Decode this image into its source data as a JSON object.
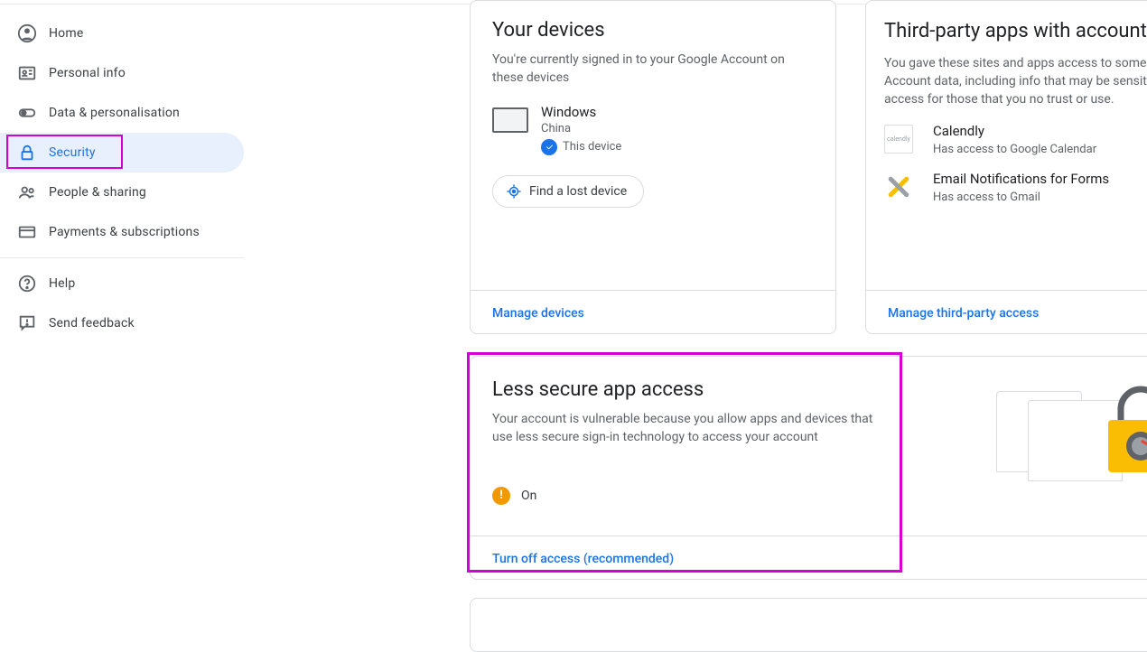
{
  "sidebar": {
    "items": [
      {
        "label": "Home"
      },
      {
        "label": "Personal info"
      },
      {
        "label": "Data & personalisation"
      },
      {
        "label": "Security"
      },
      {
        "label": "People & sharing"
      },
      {
        "label": "Payments & subscriptions"
      }
    ],
    "secondary": [
      {
        "label": "Help"
      },
      {
        "label": "Send feedback"
      }
    ]
  },
  "devices": {
    "title": "Your devices",
    "subtitle": "You're currently signed in to your Google Account on these devices",
    "device_name": "Windows",
    "device_location": "China",
    "this_device_label": "This device",
    "find_button": "Find a lost device",
    "manage_link": "Manage devices"
  },
  "third_party": {
    "title": "Third-party apps with account access",
    "subtitle": "You gave these sites and apps access to some Google Account data, including info that may be sensitive. Remove access for those that you no trust or use.",
    "apps": [
      {
        "name": "Calendly",
        "sub": "Has access to Google Calendar"
      },
      {
        "name": "Email Notifications for Forms",
        "sub": "Has access to Gmail"
      }
    ],
    "manage_link": "Manage third-party access"
  },
  "less_secure": {
    "title": "Less secure app access",
    "subtitle": "Your account is vulnerable because you allow apps and devices that use less secure sign-in technology to access your account",
    "status": "On",
    "turn_off_link": "Turn off access (recommended)"
  }
}
